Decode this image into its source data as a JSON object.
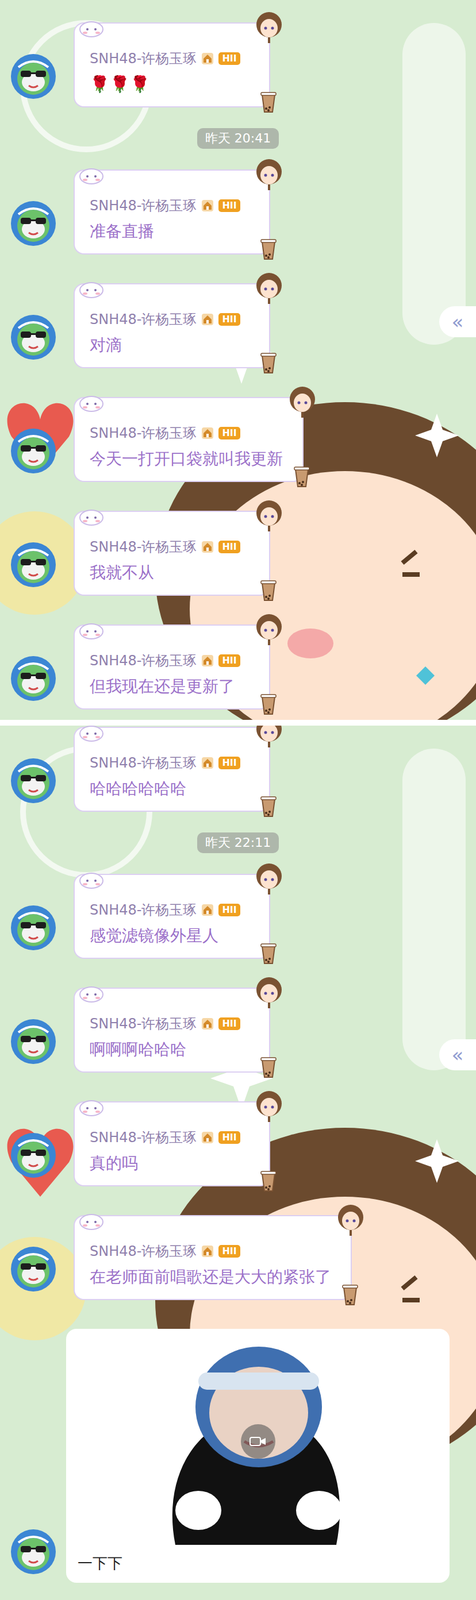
{
  "screens": [
    {
      "side_tab": "«",
      "items": [
        {
          "kind": "text",
          "sender": "SNH48-许杨玉琢",
          "badge": "HII",
          "text": "🌹🌹🌹"
        },
        {
          "kind": "time",
          "text": "昨天 20:41"
        },
        {
          "kind": "text",
          "sender": "SNH48-许杨玉琢",
          "badge": "HII",
          "text": "准备直播"
        },
        {
          "kind": "text",
          "sender": "SNH48-许杨玉琢",
          "badge": "HII",
          "text": "对滴"
        },
        {
          "kind": "text",
          "sender": "SNH48-许杨玉琢",
          "badge": "HII",
          "text": "今天一打开口袋就叫我更新"
        },
        {
          "kind": "text",
          "sender": "SNH48-许杨玉琢",
          "badge": "HII",
          "text": "我就不从"
        },
        {
          "kind": "text",
          "sender": "SNH48-许杨玉琢",
          "badge": "HII",
          "text": "但我现在还是更新了"
        }
      ]
    },
    {
      "side_tab": "«",
      "items": [
        {
          "kind": "text",
          "sender": "SNH48-许杨玉琢",
          "badge": "HII",
          "text": "哈哈哈哈哈哈"
        },
        {
          "kind": "time",
          "text": "昨天 22:11"
        },
        {
          "kind": "text",
          "sender": "SNH48-许杨玉琢",
          "badge": "HII",
          "text": "感觉滤镜像外星人"
        },
        {
          "kind": "text",
          "sender": "SNH48-许杨玉琢",
          "badge": "HII",
          "text": "啊啊啊哈哈哈"
        },
        {
          "kind": "text",
          "sender": "SNH48-许杨玉琢",
          "badge": "HII",
          "text": "真的吗"
        },
        {
          "kind": "text",
          "sender": "SNH48-许杨玉琢",
          "badge": "HII",
          "text": "在老师面前唱歌还是大大的紧张了"
        },
        {
          "kind": "video",
          "caption": "一下下"
        }
      ]
    }
  ]
}
